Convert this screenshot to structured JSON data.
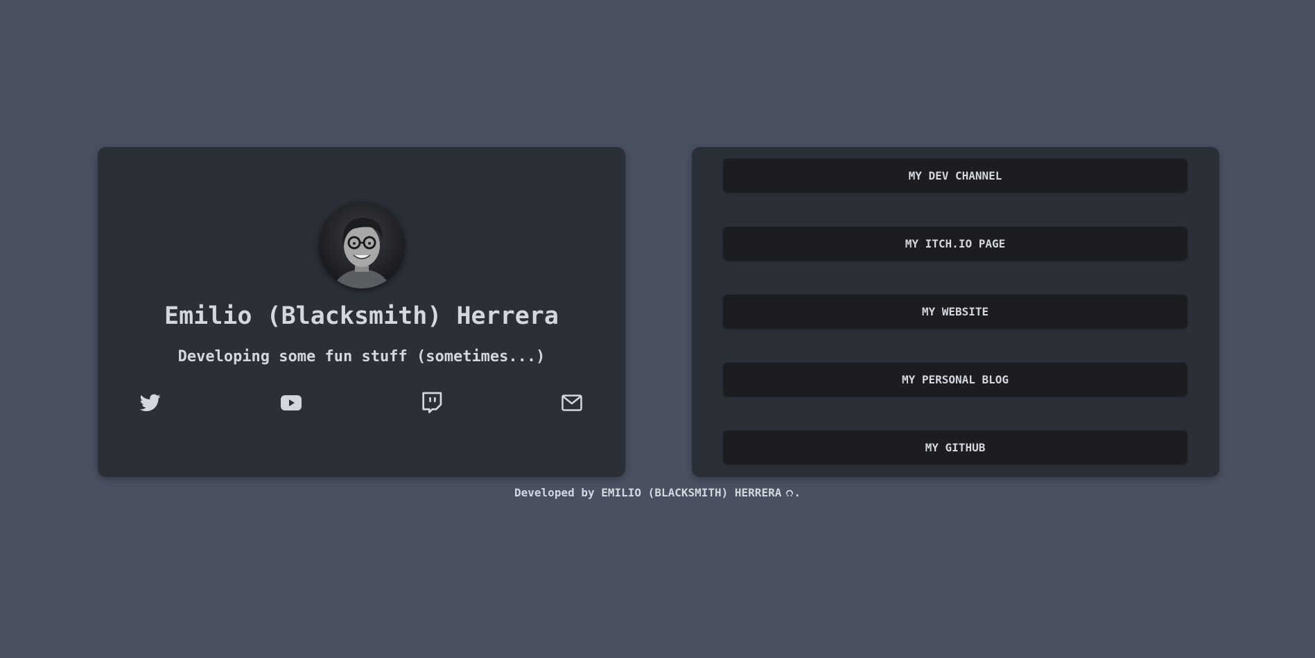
{
  "profile": {
    "name": "Emilio (Blacksmith) Herrera",
    "tagline": "Developing some fun stuff (sometimes...)",
    "social_icons": [
      "twitter-icon",
      "youtube-icon",
      "twitch-icon",
      "mail-icon"
    ]
  },
  "links": [
    {
      "label": "MY DEV CHANNEL"
    },
    {
      "label": "MY ITCH.IO PAGE"
    },
    {
      "label": "MY WEBSITE"
    },
    {
      "label": "MY PERSONAL BLOG"
    },
    {
      "label": "MY GITHUB"
    }
  ],
  "footer": {
    "prefix": "Developed by",
    "author": "EMILIO (BLACKSMITH) HERRERA",
    "suffix": ".",
    "icon": "github-icon"
  },
  "colors": {
    "background": "#495060",
    "card": "#2b2f38",
    "button": "#1b1d21",
    "text": "#d3d7de"
  }
}
